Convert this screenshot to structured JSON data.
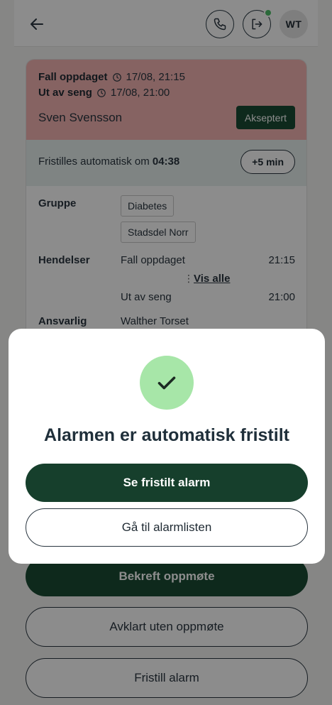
{
  "header": {
    "avatar_initials": "WT",
    "icons": [
      "arrow-left-icon",
      "phone-icon",
      "logout-icon"
    ],
    "online_status_color": "#4fc06b"
  },
  "alarm": {
    "events": [
      {
        "title": "Fall oppdaget",
        "timestamp": "17/08, 21:15"
      },
      {
        "title": "Ut av seng",
        "timestamp": "17/08, 21:00"
      }
    ],
    "patient_name": "Sven Svensson",
    "status_badge": "Akseptert",
    "header_color": "#f5b5b2",
    "release": {
      "text": "Fristilles automatisk om",
      "countdown": "04:38",
      "extend_label": "+5 min"
    },
    "details": {
      "group_label": "Gruppe",
      "groups": [
        "Diabetes",
        "Stadsdel Norr"
      ],
      "events_label": "Hendelser",
      "event_list": [
        {
          "name": "Fall oppdaget",
          "time": "21:15"
        },
        {
          "name": "Ut av seng",
          "time": "21:00"
        }
      ],
      "show_all_label": "Vis alle",
      "responsible_label": "Ansvarlig",
      "responsible_name": "Walther Torset"
    }
  },
  "actions": {
    "confirm_presence": "Bekreft oppmøte",
    "resolved_without_presence": "Avklart uten oppmøte",
    "release_alarm": "Fristill alarm"
  },
  "modal": {
    "icon": "check-icon",
    "success_color": "#a7e6a8",
    "title": "Alarmen er automatisk fristilt",
    "primary_button": "Se fristilt alarm",
    "secondary_button": "Gå til alarmlisten"
  }
}
